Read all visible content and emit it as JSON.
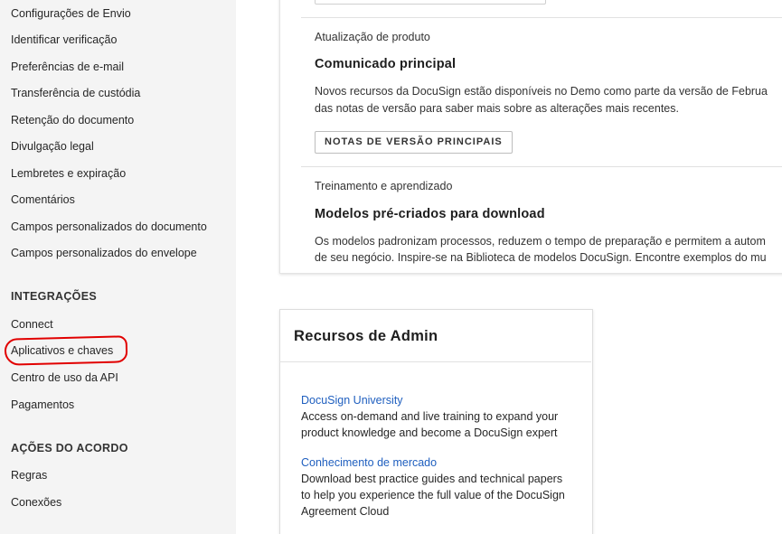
{
  "sidebar": {
    "items_top": [
      "Configurações de Envio",
      "Identificar verificação",
      "Preferências de e-mail",
      "Transferência de custódia",
      "Retenção do documento",
      "Divulgação legal",
      "Lembretes e expiração",
      "Comentários",
      "Campos personalizados do documento",
      "Campos personalizados do envelope"
    ],
    "integrations_heading": "INTEGRAÇÕES",
    "integrations": [
      "Connect",
      "Aplicativos e chaves",
      "Centro de uso da API",
      "Pagamentos"
    ],
    "agreement_heading": "AÇÕES DO ACORDO",
    "agreement": [
      "Regras",
      "Conexões"
    ],
    "highlighted_item": "Aplicativos e chaves",
    "highlight_color": "#e10000"
  },
  "main": {
    "product_update": {
      "eyebrow": "Atualização de produto",
      "title": "Comunicado principal",
      "body_line1": "Novos recursos da DocuSign estão disponíveis no Demo como parte da versão de Februa",
      "body_line2": "das notas de versão para saber mais sobre as alterações mais recentes.",
      "button_label": "NOTAS DE VERSÃO PRINCIPAIS"
    },
    "training": {
      "eyebrow": "Treinamento e aprendizado",
      "title": "Modelos pré-criados para download",
      "body_line1": "Os modelos padronizam processos, reduzem o tempo de preparação e permitem a autom",
      "body_line2": "de seu negócio. Inspire-se na Biblioteca de modelos DocuSign. Encontre exemplos do mu"
    },
    "admin_resources": {
      "title": "Recursos de Admin",
      "university_link": "DocuSign University",
      "university_desc1": "Access on-demand and live training to expand your",
      "university_desc2": "product knowledge and become a DocuSign expert",
      "market_link": "Conhecimento de mercado",
      "market_desc1": "Download best practice guides and technical papers",
      "market_desc2": "to help you experience the full value of the DocuSign",
      "market_desc3": "Agreement Cloud"
    }
  },
  "colors": {
    "sidebar_bg": "#f4f4f4",
    "link": "#1f5fbf"
  }
}
